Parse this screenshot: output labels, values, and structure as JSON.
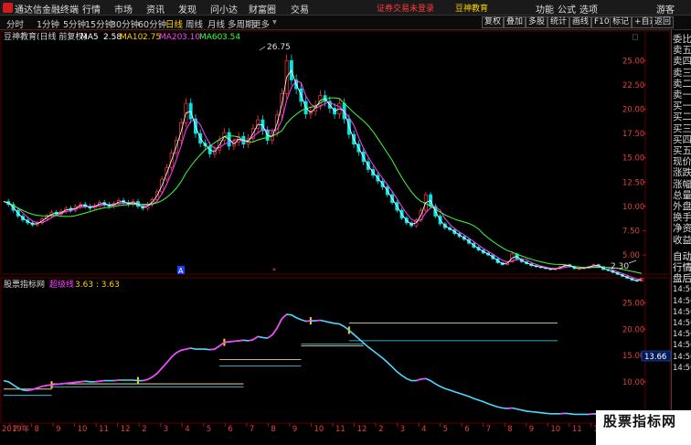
{
  "app": {
    "name": "通达信金融终端",
    "menu": [
      "行情",
      "市场",
      "资讯",
      "发现",
      "问小达",
      "财富圈",
      "交易"
    ],
    "warning_login": "证券交易未登录",
    "warning_brand": "豆神教育",
    "right_menu": [
      "功能",
      "公式",
      "选项"
    ],
    "guest": "游客"
  },
  "toolbar": {
    "timeframes": [
      "分时",
      "1分钟",
      "5分钟",
      "15分钟",
      "30分钟",
      "60分钟",
      "日线",
      "周线",
      "月线",
      "多周期",
      "更多"
    ],
    "active": "日线",
    "buttons": [
      "复权",
      "叠加",
      "多股",
      "统计",
      "画线",
      "F10",
      "标记",
      "+自选",
      "返回"
    ]
  },
  "main_chart": {
    "stock": "豆神教育(日线 前复权)",
    "ma": [
      {
        "label": "MA5",
        "value": "2.58",
        "color": "#ffffff"
      },
      {
        "label": "MA10",
        "value": "2.75",
        "color": "#ffd200"
      },
      {
        "label": "MA20",
        "value": "3.10",
        "color": "#ff40ff"
      },
      {
        "label": "MA60",
        "value": "3.54",
        "color": "#3cff3c"
      }
    ],
    "high_label": "26.75",
    "low_label": "2.30",
    "y_ticks": [
      "25.00",
      "22.50",
      "20.00",
      "17.50",
      "15.00",
      "12.50",
      "10.00",
      "7.50",
      "5.00"
    ],
    "marker": "A"
  },
  "sub_chart": {
    "name": "股票指标网",
    "indicator_name": "超级线",
    "values": "3.63 : 3.63",
    "y_ticks": [
      "25.00",
      "20.00",
      "15.00",
      "10.00"
    ],
    "cursor_value": "13.66"
  },
  "x_axis": {
    "labels": [
      "2019年",
      "7",
      "8",
      "9",
      "10",
      "11",
      "12",
      "2",
      "3",
      "4",
      "5",
      "6",
      "7",
      "8",
      "9",
      "10",
      "11",
      "12",
      "2",
      "3",
      "4",
      "5",
      "6",
      "7",
      "8",
      "9",
      "10",
      "11",
      "12",
      "1",
      "2"
    ]
  },
  "right_panel": [
    "委比",
    "卖五",
    "卖四",
    "卖三",
    "卖二",
    "卖一",
    "买一",
    "买二",
    "买三",
    "买四",
    "买五",
    "现价",
    "涨跌",
    "涨幅",
    "总量",
    "外盘",
    "换手",
    "净资",
    "收益",
    "自动",
    "行情",
    "盘后",
    "14:50",
    "14:50",
    "14:50",
    "14:50",
    "14:50",
    "14:50",
    "14:50",
    "14:50"
  ],
  "chart_data": {
    "type": "line",
    "series": [
      {
        "name": "",
        "values": [
          10.5,
          10.2,
          9.6,
          9.0,
          8.6,
          8.3,
          8.1,
          8.3,
          8.7,
          9.0,
          9.4,
          9.2,
          9.5,
          9.8,
          9.6,
          10.0,
          10.2,
          10.0,
          9.8,
          10.1,
          10.4,
          10.2,
          10.0,
          10.3,
          10.6,
          10.4,
          10.2,
          10.5,
          10.0,
          9.8,
          10.2,
          10.7,
          11.5,
          12.8,
          14.0,
          15.5,
          16.8,
          18.6,
          20.6,
          19.0,
          17.5,
          16.5,
          16.2,
          15.4,
          15.8,
          16.8,
          17.6,
          16.2,
          16.6,
          17.2,
          16.4,
          17.0,
          18.0,
          18.9,
          17.8,
          16.8,
          17.6,
          19.4,
          21.6,
          25.0,
          23.0,
          22.1,
          20.8,
          19.5,
          19.8,
          20.4,
          21.4,
          20.8,
          20.1,
          19.5,
          20.6,
          19.0,
          17.4,
          16.4,
          15.6,
          14.6,
          13.8,
          13.2,
          12.6,
          12.0,
          11.2,
          10.4,
          9.6,
          8.8,
          8.3,
          8.0,
          8.6,
          9.6,
          11.2,
          10.0,
          9.0,
          8.2,
          7.8,
          7.6,
          7.2,
          6.9,
          6.6,
          6.2,
          5.8,
          5.5,
          5.2,
          5.0,
          4.6,
          4.2,
          4.0,
          4.3,
          5.1,
          4.6,
          4.3,
          4.1,
          3.9,
          3.8,
          3.7,
          3.6,
          3.5,
          3.6,
          3.8,
          4.0,
          3.8,
          3.6,
          3.6,
          3.7,
          3.8,
          4.0,
          3.8,
          3.5,
          3.4,
          3.2,
          3.0,
          2.8,
          2.6,
          2.4,
          2.3,
          2.6
        ]
      },
      {
        "name": "超级线",
        "values": [
          10.2,
          10.0,
          9.4,
          8.8,
          8.4,
          8.3,
          8.5,
          8.8,
          9.1,
          9.3,
          9.4,
          9.5,
          9.6,
          9.7,
          9.8,
          9.9,
          10.0,
          10.1,
          10.0,
          10.0,
          10.1,
          10.2,
          10.2,
          10.2,
          10.3,
          10.3,
          10.3,
          10.3,
          10.2,
          10.2,
          10.4,
          10.9,
          11.6,
          12.6,
          13.6,
          14.7,
          15.5,
          16.0,
          16.2,
          16.4,
          16.2,
          16.2,
          16.2,
          16.1,
          16.2,
          16.8,
          17.5,
          17.6,
          17.7,
          17.8,
          17.9,
          17.8,
          18.0,
          18.6,
          18.4,
          18.3,
          18.9,
          20.2,
          22.0,
          22.8,
          22.7,
          22.2,
          21.8,
          21.5,
          21.6,
          21.6,
          21.7,
          21.5,
          21.3,
          21.1,
          21.0,
          20.5,
          19.8,
          19.0,
          18.2,
          17.4,
          16.6,
          15.9,
          15.2,
          14.5,
          13.7,
          12.8,
          11.9,
          11.2,
          10.6,
          10.2,
          10.2,
          10.5,
          10.6,
          10.2,
          9.6,
          9.1,
          8.7,
          8.4,
          8.1,
          7.8,
          7.5,
          7.2,
          6.8,
          6.5,
          6.2,
          5.8,
          5.5,
          5.2,
          5.0,
          4.9,
          5.0,
          4.8,
          4.6,
          4.4,
          4.3,
          4.2,
          4.1,
          4.0,
          3.9,
          3.9,
          3.9,
          4.0,
          3.9,
          3.8,
          3.8,
          3.8,
          3.8,
          3.9,
          3.8,
          3.7,
          3.6,
          3.5,
          3.4,
          3.3,
          3.2,
          3.1,
          3.0,
          3.1
        ]
      }
    ],
    "ylim_main": [
      3.5,
      27.0
    ],
    "ylim_sub": [
      3.0,
      27.0
    ],
    "grid": false
  }
}
